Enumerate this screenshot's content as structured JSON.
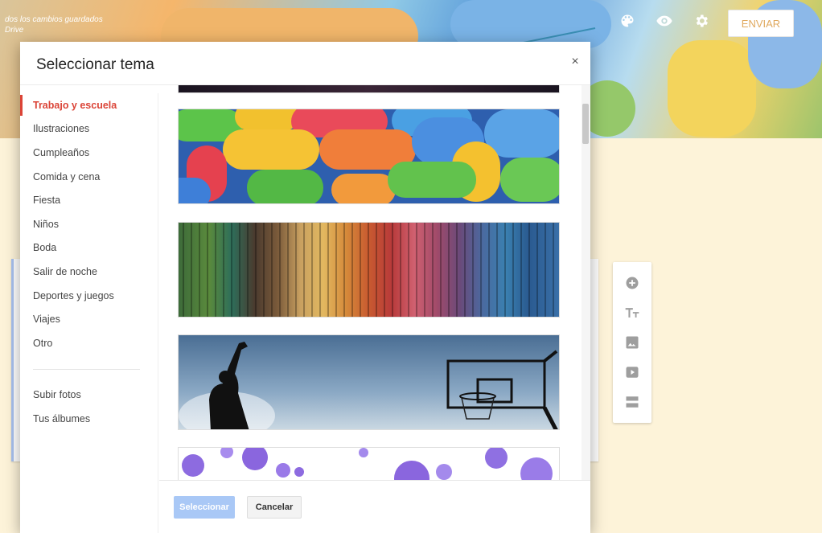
{
  "autosave": {
    "line1": "dos los cambios guardados",
    "line2": "Drive"
  },
  "toolbar": {
    "send_label": "ENVIAR",
    "icons": [
      "palette-icon",
      "eye-icon",
      "gear-icon"
    ]
  },
  "dialog": {
    "title": "Seleccionar tema",
    "close_glyph": "×",
    "categories": [
      {
        "label": "Trabajo y escuela",
        "active": true
      },
      {
        "label": "Ilustraciones"
      },
      {
        "label": "Cumpleaños"
      },
      {
        "label": "Comida y cena"
      },
      {
        "label": "Fiesta"
      },
      {
        "label": "Niños"
      },
      {
        "label": "Boda"
      },
      {
        "label": "Salir de noche"
      },
      {
        "label": "Deportes y juegos"
      },
      {
        "label": "Viajes"
      },
      {
        "label": "Otro"
      }
    ],
    "extra": [
      {
        "label": "Subir fotos"
      },
      {
        "label": "Tus álbumes"
      }
    ],
    "thumbnails": [
      "dark-header-image",
      "candy-pills-image",
      "colored-threads-image",
      "basketball-silhouette-image",
      "purple-bubbles-image"
    ],
    "select_label": "Seleccionar",
    "cancel_label": "Cancelar"
  },
  "side_tools": [
    "add-question-icon",
    "title-text-icon",
    "image-icon",
    "video-icon",
    "section-icon"
  ],
  "colors": {
    "accent_red": "#db4437",
    "select_button": "#a9c8f6",
    "send_text": "#e0a95f",
    "form_bg": "#fdf3d9"
  }
}
